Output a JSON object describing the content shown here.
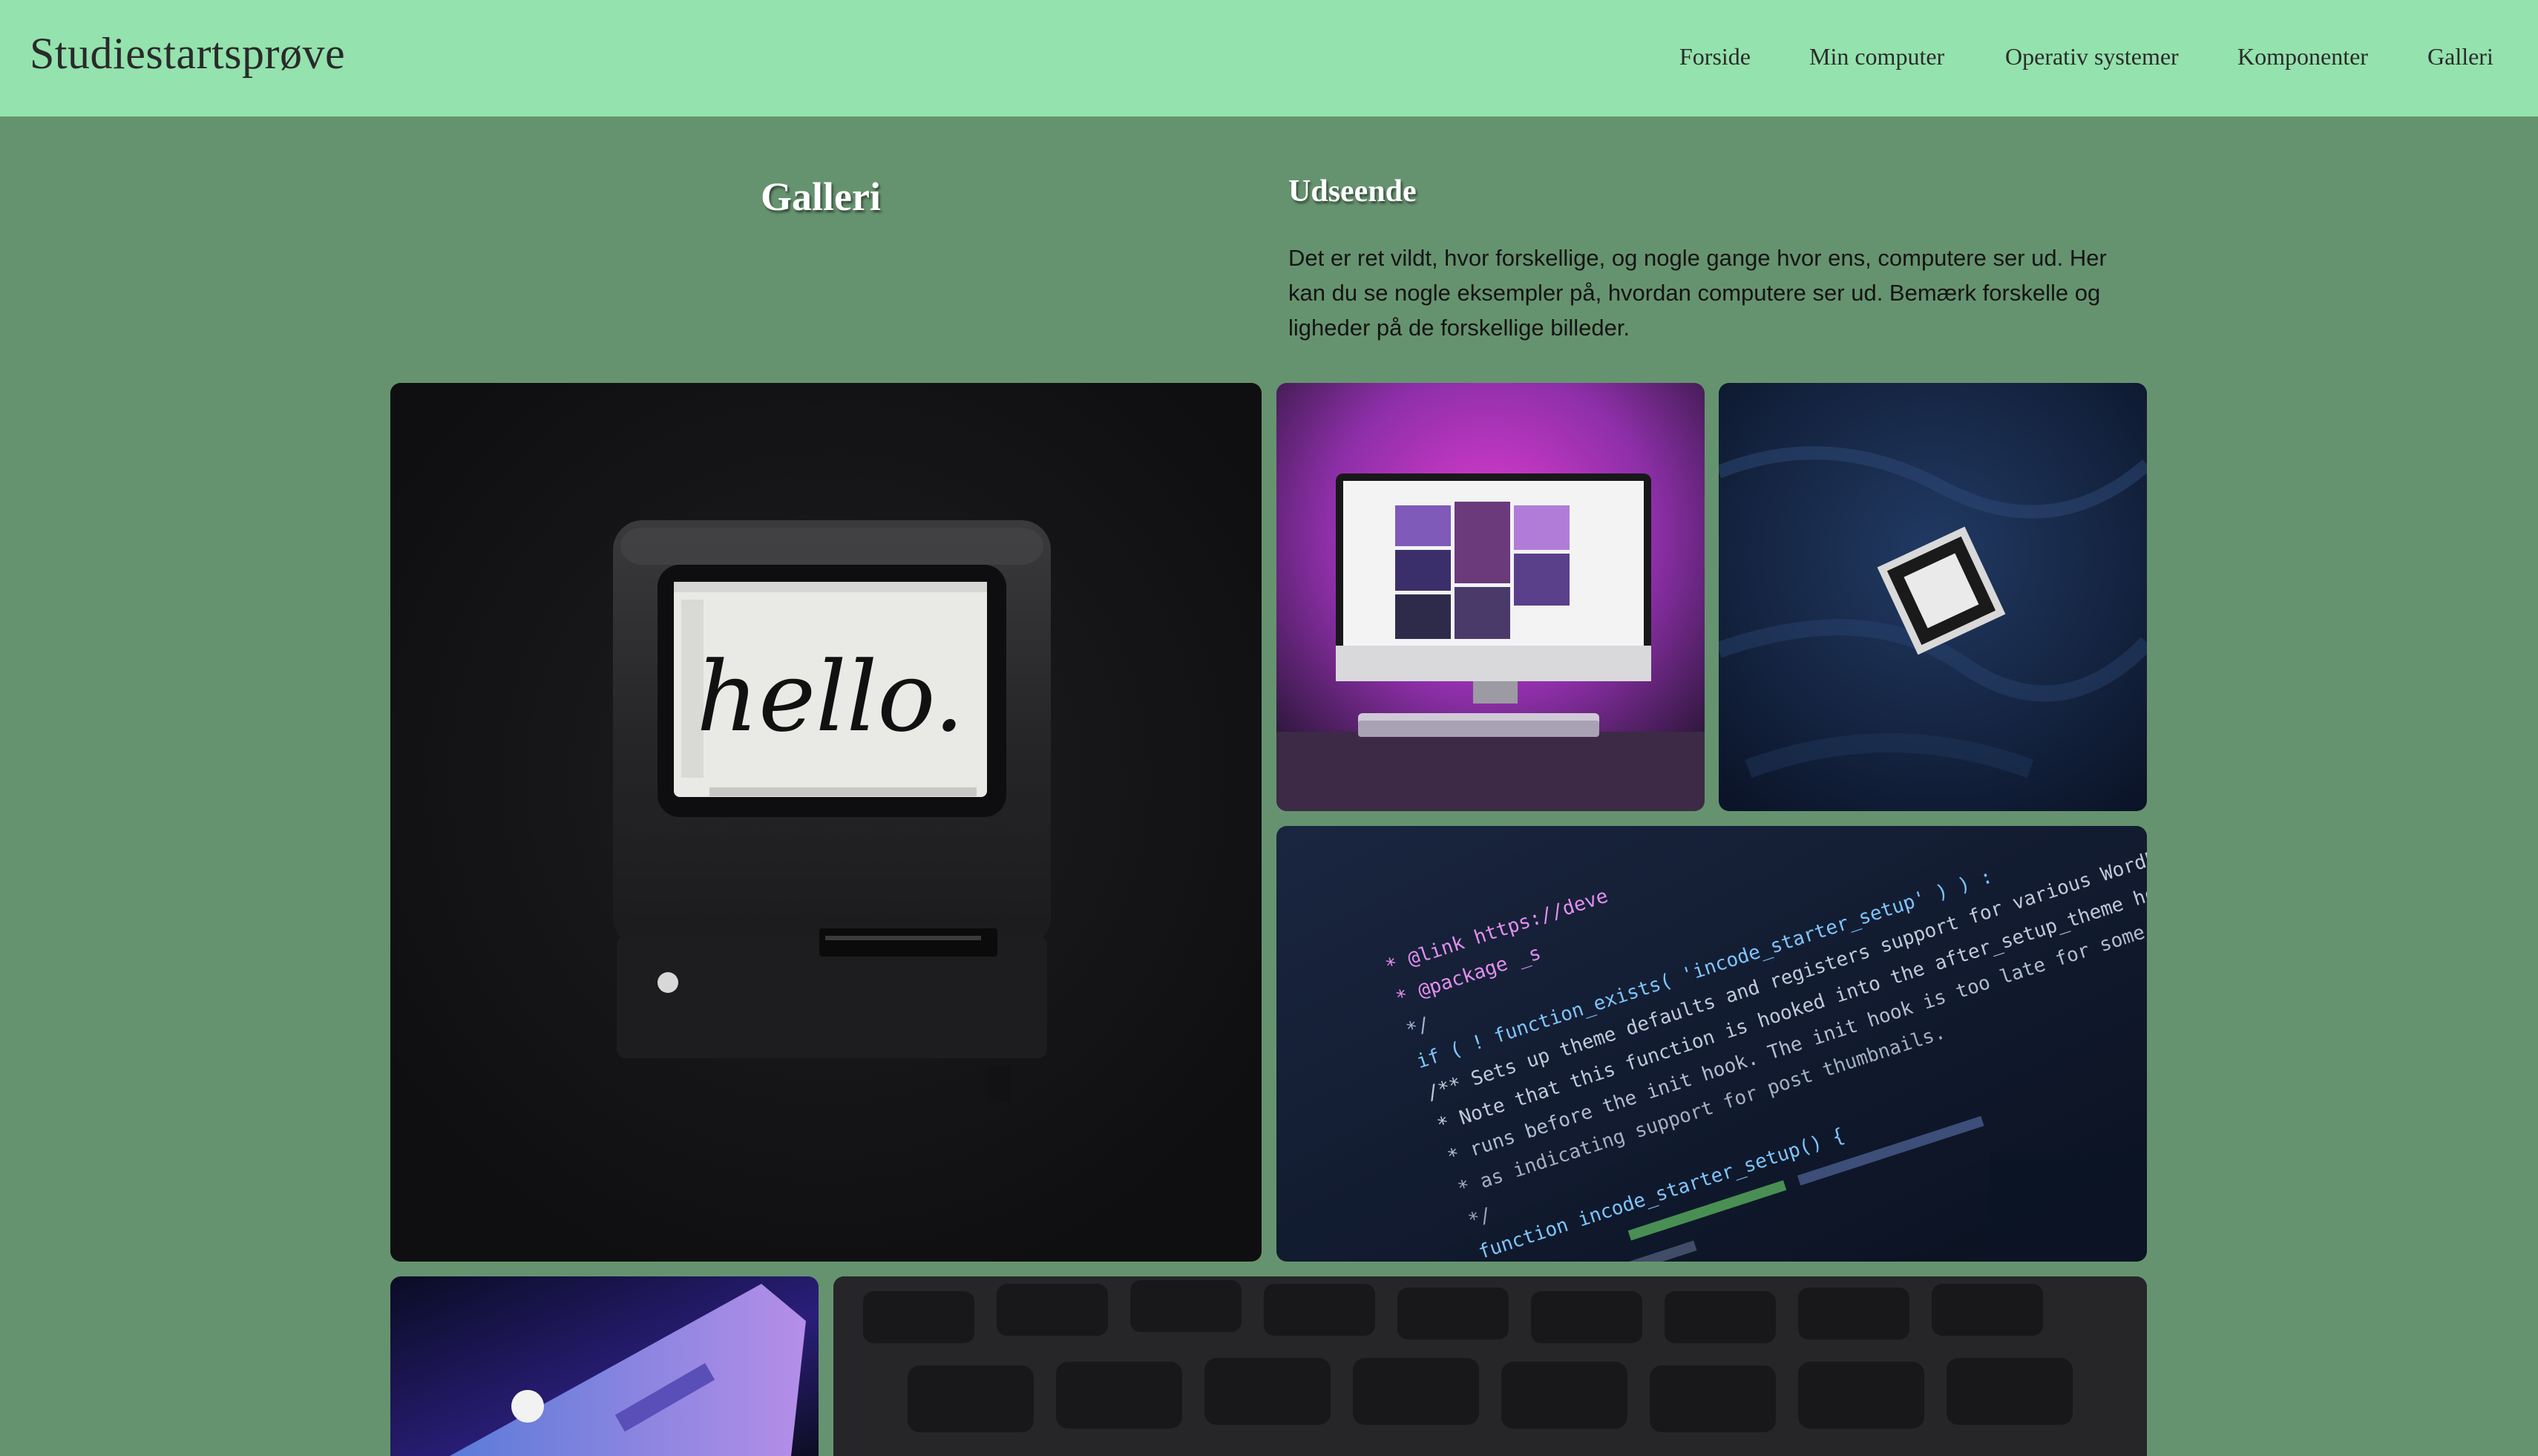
{
  "header": {
    "brand": "Studiestartsprøve",
    "nav": [
      "Forside",
      "Min computer",
      "Operativ systemer",
      "Komponenter",
      "Galleri"
    ]
  },
  "gallery": {
    "title": "Galleri",
    "section_title": "Udseende",
    "description": "Det er ret vildt, hvor forskellige, og nogle gange hvor ens, computere ser ud. Her kan du se nogle eksempler på, hvordan computere ser ud. Bemærk forskelle og ligheder på de forskellige billeder.",
    "images": [
      {
        "name": "vintage-macintosh-hello",
        "screen_text": "hello."
      },
      {
        "name": "imac-pink-desk"
      },
      {
        "name": "cpu-chip-on-fabric"
      },
      {
        "name": "code-screen"
      },
      {
        "name": "macbook-purple-light"
      },
      {
        "name": "keyboard-closeup"
      }
    ]
  },
  "code_lines": [
    "* @link https://deve",
    "* @package _s",
    "*/",
    "if ( ! function_exists( 'incode_starter_setup' ) ) :",
    "/** Sets up theme defaults and registers support for various WordPress",
    " * Note that this function is hooked into the after_setup_theme hook, which",
    " * runs before the init hook. The init hook is too late for some features,",
    " * as indicating support for post thumbnails.",
    " */",
    "function incode_starter_setup() {"
  ],
  "colors": {
    "header_bg": "#94e2ad",
    "page_bg": "#66936f",
    "title_text": "#ffffff",
    "body_text": "#141414"
  }
}
